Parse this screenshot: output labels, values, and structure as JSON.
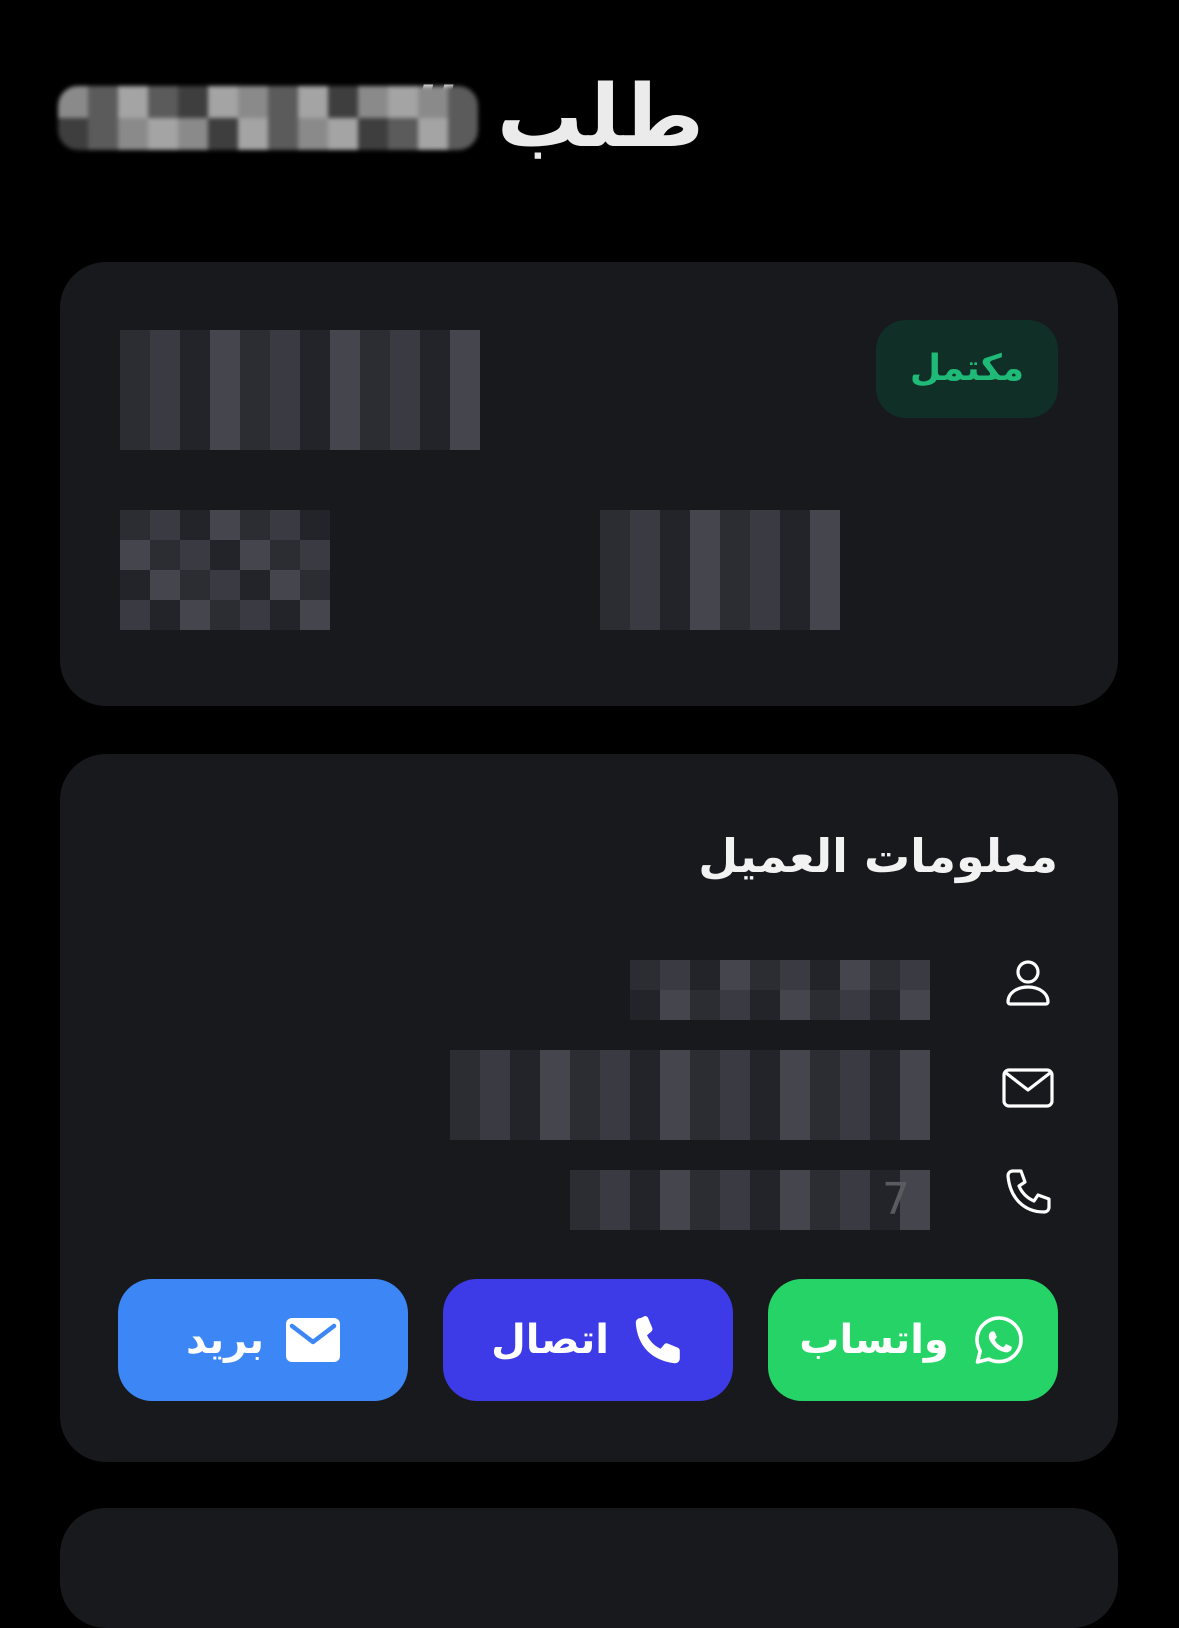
{
  "header": {
    "title": "طلب #",
    "order_number_redacted": true
  },
  "order_card": {
    "status_badge": "مكتمل",
    "status_color": "#1fba78",
    "details_redacted": true
  },
  "customer_card": {
    "title": "معلومات العميل",
    "fields": [
      {
        "icon": "person-icon",
        "value_redacted": true
      },
      {
        "icon": "mail-icon",
        "value_redacted": true
      },
      {
        "icon": "phone-icon",
        "value_redacted": true,
        "visible_suffix": "7"
      }
    ],
    "actions": {
      "whatsapp_label": "واتساب",
      "whatsapp_icon": "whatsapp-icon",
      "whatsapp_color": "#25d366",
      "call_label": "اتصال",
      "call_icon": "phone-icon",
      "call_color": "#3d3ae8",
      "email_label": "بريد",
      "email_icon": "envelope-icon",
      "email_color": "#3d86f6"
    }
  }
}
